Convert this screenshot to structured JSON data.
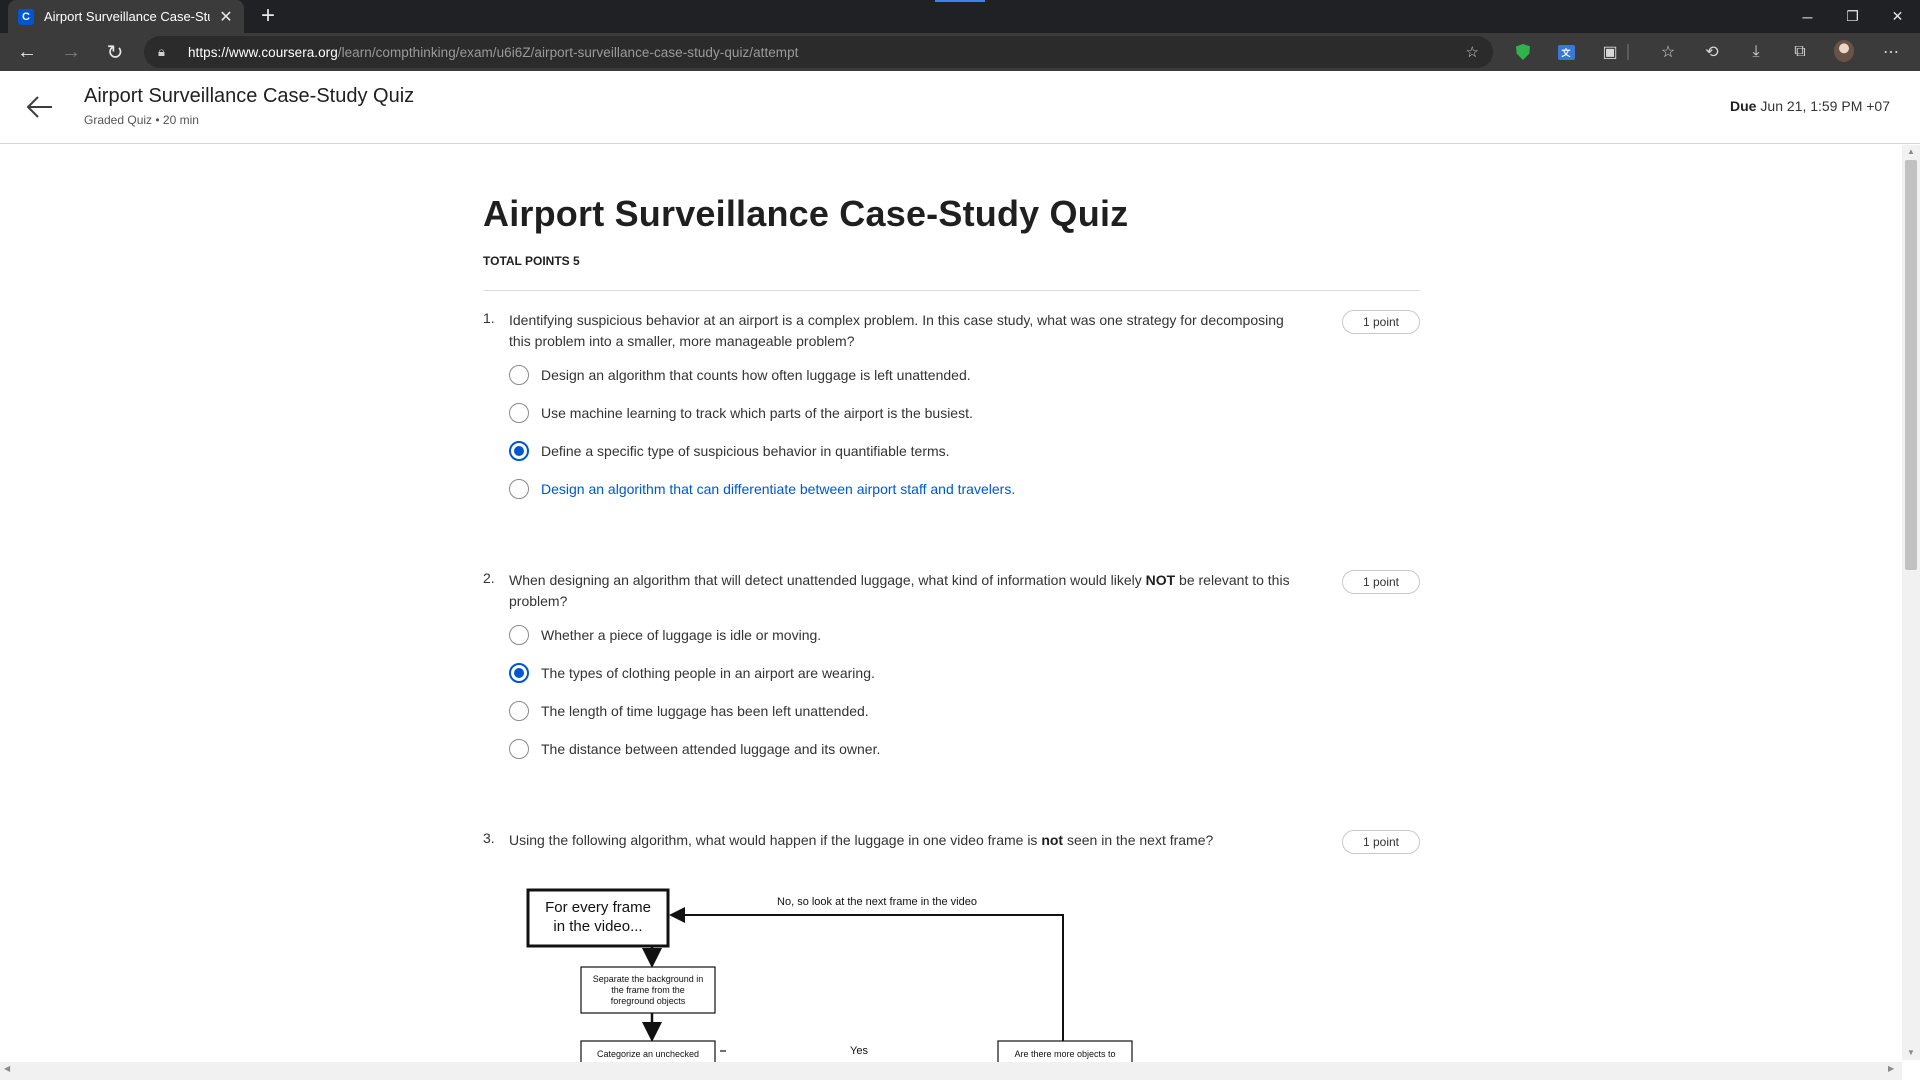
{
  "browser": {
    "tab_title": "Airport Surveillance Case-Study Quiz | Coursera",
    "tab_favicon": "C",
    "url_host": "https://www.coursera.org",
    "url_path": "/learn/compthinking/exam/u6i6Z/airport-surveillance-case-study-quiz/attempt",
    "icons": [
      "back-icon",
      "forward-icon",
      "reload-icon",
      "lock-icon",
      "add-favorite-icon",
      "shield-extension-icon",
      "translate-extension-icon",
      "collections-icon",
      "favorites-icon",
      "history-icon",
      "downloads-icon",
      "extensions-icon",
      "profile-avatar",
      "more-icon"
    ]
  },
  "header": {
    "title": "Airport Surveillance Case-Study Quiz",
    "subtitle": "Graded Quiz • 20 min",
    "due_label": "Due",
    "due_value": "Jun 21, 1:59 PM +07"
  },
  "quiz": {
    "title": "Airport Surveillance Case-Study Quiz",
    "total_points": "TOTAL POINTS 5",
    "questions": [
      {
        "number": "1.",
        "text": "Identifying suspicious behavior at an airport is a complex problem. In this case study, what was one strategy for decomposing this problem into a smaller, more manageable problem?",
        "points": "1 point",
        "options": [
          "Design an algorithm that counts how often luggage is left unattended.",
          "Use machine learning to track which parts of the airport is the busiest.",
          "Define a specific type of suspicious behavior in quantifiable terms.",
          "Design an algorithm that can differentiate between airport staff and travelers."
        ],
        "selected_index": 2
      },
      {
        "number": "2.",
        "text_before": "When designing an algorithm that will detect unattended luggage, what kind of information would likely ",
        "text_bold": "NOT",
        "text_after": " be relevant to this problem?",
        "points": "1 point",
        "options": [
          "Whether a piece of luggage is idle or moving.",
          "The types of clothing people in an airport are wearing.",
          "The length of time luggage has been left unattended.",
          "The distance between attended luggage and its owner."
        ],
        "selected_index": 1
      },
      {
        "number": "3.",
        "text_before": "Using the following algorithm, what would happen if the luggage in one video frame is ",
        "text_bold": "not",
        "text_after": " seen in the next frame?",
        "points": "1 point",
        "diagram": {
          "box_start": [
            "For every frame",
            "in the video..."
          ],
          "box_separate": [
            "Separate the background in",
            "the frame from the",
            "foreground objects"
          ],
          "box_categorize": "Categorize an unchecked",
          "box_more": "Are there more objects to",
          "loop_label": "No, so look at the next frame in the video",
          "yes_label": "Yes"
        }
      }
    ]
  }
}
